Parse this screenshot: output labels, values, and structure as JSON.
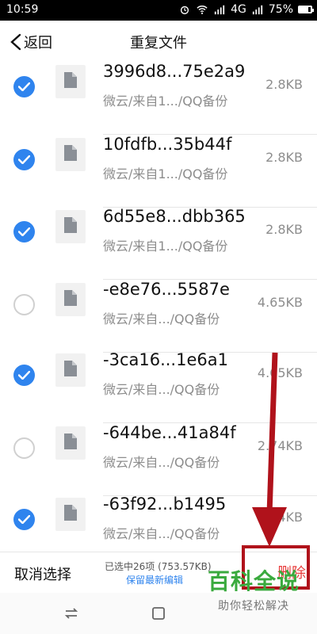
{
  "status": {
    "time": "10:59",
    "network": "4G",
    "battery": "75%"
  },
  "header": {
    "back_label": "返回",
    "title": "重复文件"
  },
  "files": [
    {
      "name": "3996d8...75e2a9",
      "path": "微云/来自1.../QQ备份",
      "size": "2.8KB",
      "checked": true
    },
    {
      "name": "10fdfb...35b44f",
      "path": "微云/来自1.../QQ备份",
      "size": "2.8KB",
      "checked": true
    },
    {
      "name": "6d55e8...dbb365",
      "path": "微云/来自1.../QQ备份",
      "size": "2.8KB",
      "checked": true
    },
    {
      "name": "-e8e76...5587e",
      "path": "微云/来自.../QQ备份",
      "size": "4.65KB",
      "checked": false
    },
    {
      "name": "-3ca16...1e6a1",
      "path": "微云/来自.../QQ备份",
      "size": "4.65KB",
      "checked": true
    },
    {
      "name": "-644be...41a84f",
      "path": "微云/来自.../QQ备份",
      "size": "2.74KB",
      "checked": false
    },
    {
      "name": "-63f92...b1495",
      "path": "微云/来自.../QQ备份",
      "size": "2.74KB",
      "checked": true
    }
  ],
  "actionbar": {
    "cancel_label": "取消选择",
    "summary": "已选中26项 (753.57KB)",
    "keep_latest": "保留最新编辑",
    "delete_label": "删除"
  },
  "watermark": {
    "brand": "百科全说",
    "slogan": "助你轻松解决"
  },
  "colors": {
    "accent": "#2f84ee",
    "danger": "#e83b3b",
    "annotation": "#b0121b",
    "watermark": "#3aaa3e"
  }
}
